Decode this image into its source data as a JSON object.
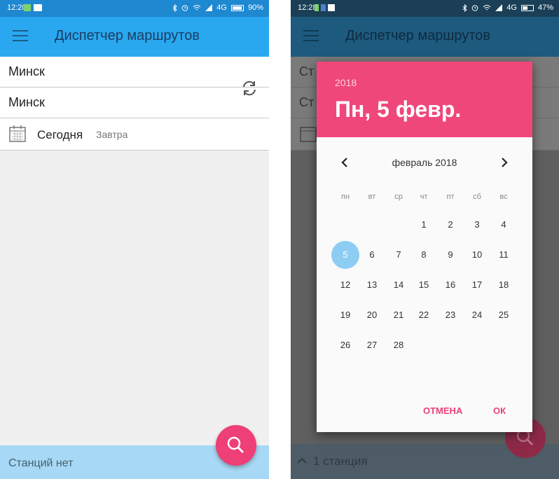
{
  "left": {
    "status": {
      "time": "12:20",
      "battery_percent": 90,
      "battery_text": "90%",
      "signal_text": "4G"
    },
    "toolbar": {
      "title": "Диспетчер маршрутов"
    },
    "from_station": "Минск",
    "to_station": "Минск",
    "date": {
      "today": "Сегодня",
      "tomorrow": "Завтра"
    },
    "bottom_bar": {
      "text": "Станций нет"
    }
  },
  "right": {
    "status": {
      "time": "12:28",
      "battery_percent": 47,
      "battery_text": "47%",
      "signal_text": "4G"
    },
    "toolbar": {
      "title": "Диспетчер маршрутов"
    },
    "behind_field_1": "Ст",
    "behind_field_2": "Ст",
    "bottom_bar": {
      "text": "1 станция"
    },
    "dialog": {
      "year": "2018",
      "selected_date": "Пн, 5 февр.",
      "month_label": "февраль 2018",
      "weekdays": [
        "пн",
        "вт",
        "ср",
        "чт",
        "пт",
        "сб",
        "вс"
      ],
      "days": [
        "1",
        "2",
        "3",
        "4",
        "5",
        "6",
        "7",
        "8",
        "9",
        "10",
        "11",
        "12",
        "13",
        "14",
        "15",
        "16",
        "17",
        "18",
        "19",
        "20",
        "21",
        "22",
        "23",
        "24",
        "25",
        "26",
        "27",
        "28"
      ],
      "selected_day": "5",
      "cancel_label": "ОТМЕНА",
      "ok_label": "ОК"
    }
  },
  "colors": {
    "primary": "#29a8f0",
    "accent": "#f0477a",
    "fab": "#ee3f76",
    "bottom_bar": "#a7d8f5",
    "selected_day": "#8ecdf3"
  }
}
